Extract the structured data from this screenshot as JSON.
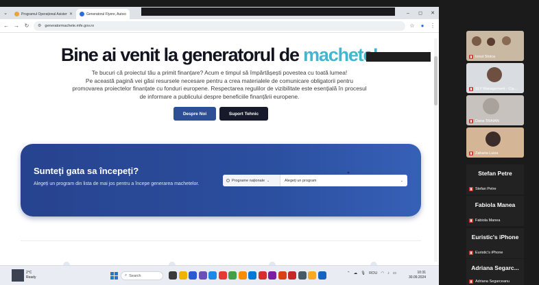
{
  "browser": {
    "tabs": [
      {
        "title": "Programul Operațional Asistență Tehnică",
        "favicon_color": "#e8a33a",
        "active": false
      },
      {
        "title": "Generatorul Flyere, Autocolante, Postere",
        "favicon_color": "#2d6cdf",
        "active": true
      }
    ],
    "url": "generatormachete.mfe.gov.ro",
    "window_controls": [
      "–",
      "◻",
      "✕"
    ]
  },
  "page": {
    "title_prefix": "Bine ai venit la generatorul de ",
    "title_accent": "machete!",
    "intro_lines": [
      "Te bucuri că proiectul tău a primit finanțare? Acum e timpul să împărtășești povestea cu toată lumea!",
      "Pe această pagină vei găsi resursele necesare pentru a crea materialele de comunicare obligatorii pentru",
      "promovarea proiectelor finanțate cu fonduri europene. Respectarea regulilor de vizibilitate este esențială în procesul",
      "de informare a publicului despre beneficiile finanțării europene."
    ],
    "buttons": {
      "about": "Despre Noi",
      "support": "Suport Tehnic"
    },
    "panel": {
      "title": "Sunteți gata sa începeți?",
      "subtitle": "Alegeți un program din lista de mai jos pentru a începe generarea machetelor.",
      "program_type": "Programe naționale",
      "program_placeholder": "Alegeți un program"
    }
  },
  "taskbar": {
    "weather_temp": "2°C",
    "weather_status": "Ready",
    "search_placeholder": "Search",
    "tray_lang": "ROU",
    "clock_time": "10:31",
    "clock_date": "30.09.2024",
    "app_icon_colors": [
      "#3a3a3a",
      "#f0b400",
      "#2a5bd7",
      "#6b4fbb",
      "#1e88e5",
      "#e53935",
      "#43a047",
      "#fb8c00",
      "#0078d4",
      "#d32f2f",
      "#7b1fa2",
      "#d84315",
      "#c62828",
      "#455a64",
      "#f9a825",
      "#1565c0"
    ]
  },
  "meeting": {
    "video_tiles": [
      {
        "name": "Ionut Stoica",
        "bg": "#c9b9a3"
      },
      {
        "name": "SLY Management - Cip...",
        "bg": "#d9dde2"
      },
      {
        "name": "Dana TRAIAN",
        "bg": "#c7c2bd"
      },
      {
        "name": "Zaharia Luiza",
        "bg": "#d4b696"
      }
    ],
    "name_tiles": [
      {
        "display": "Stefan Petre",
        "name": "Stefan Petre"
      },
      {
        "display": "Fabiola Manea",
        "name": "Fabiola Manea"
      },
      {
        "display": "Euristic's iPhone",
        "name": "Euristic's iPhone"
      },
      {
        "display": "Adriana Segarc...",
        "name": "Adriana Segarceanu"
      }
    ]
  }
}
